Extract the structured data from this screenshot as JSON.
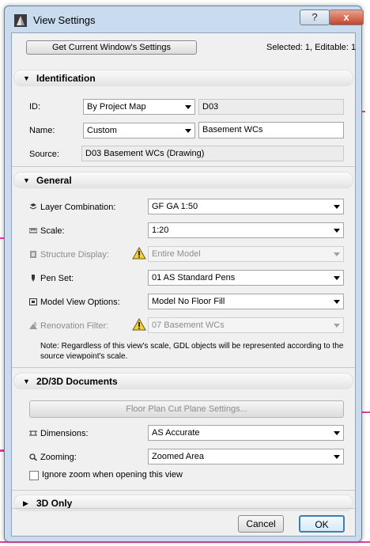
{
  "window": {
    "title": "View Settings",
    "help_label": "?",
    "close_label": "x"
  },
  "top": {
    "get_settings_label": "Get Current Window's Settings",
    "selection_status": "Selected: 1, Editable: 1"
  },
  "identification": {
    "header": "Identification",
    "id_label": "ID:",
    "id_mode": "By Project Map",
    "id_value": "D03",
    "name_label": "Name:",
    "name_mode": "Custom",
    "name_value": "Basement WCs",
    "source_label": "Source:",
    "source_value": "D03 Basement WCs (Drawing)"
  },
  "general": {
    "header": "General",
    "layer_label": "Layer Combination:",
    "layer_value": "GF GA 1:50",
    "scale_label": "Scale:",
    "scale_value": "1:20",
    "structure_label": "Structure Display:",
    "structure_value": "Entire Model",
    "penset_label": "Pen Set:",
    "penset_value": "01 AS Standard Pens",
    "mvo_label": "Model View Options:",
    "mvo_value": "Model No Floor Fill",
    "renovation_label": "Renovation Filter:",
    "renovation_value": "07 Basement WCs",
    "note": "Note: Regardless of this view's scale, GDL objects will be represented according to the source viewpoint's scale."
  },
  "docs": {
    "header": "2D/3D Documents",
    "cut_plane_label": "Floor Plan Cut Plane Settings...",
    "dimensions_label": "Dimensions:",
    "dimensions_value": "AS Accurate",
    "zooming_label": "Zooming:",
    "zooming_value": "Zoomed Area",
    "ignore_zoom_label": "Ignore zoom when opening this view",
    "ignore_zoom_checked": false
  },
  "only3d": {
    "header": "3D Only"
  },
  "footer": {
    "cancel_label": "Cancel",
    "ok_label": "OK"
  },
  "colors": {
    "window_frame": "#c9dcef",
    "background_accent": "#e23fa0",
    "ok_border": "#3c7fb1"
  }
}
